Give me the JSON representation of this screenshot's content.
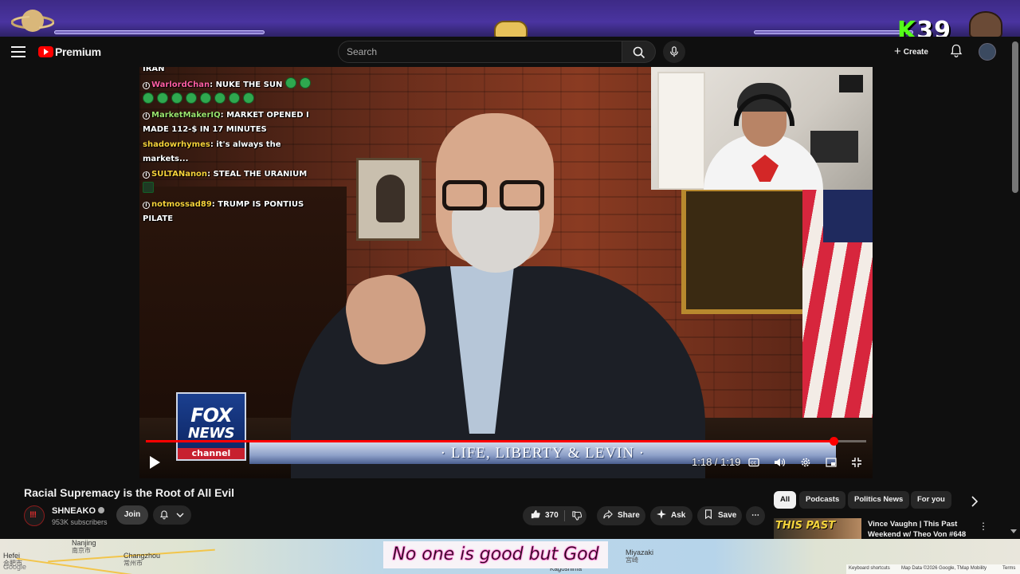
{
  "overlay": {
    "counter_k": "K",
    "counter_value": "39"
  },
  "masthead": {
    "brand": "Premium",
    "search_placeholder": "Search",
    "create_label": "Create"
  },
  "chat": [
    {
      "user": "",
      "text": "IRAN",
      "badge": false,
      "color": "#ffffff"
    },
    {
      "user": "WarlordChan",
      "text": "NUKE THE SUN",
      "badge": true,
      "color": "#ff5fa2",
      "emotes_after": 2
    },
    {
      "user": "",
      "text": "",
      "badge": false,
      "emotes_line": 8
    },
    {
      "user": "MarketMakerIQ",
      "text": "MARKET OPENED I",
      "badge": true,
      "color": "#9be36d"
    },
    {
      "user": "",
      "text": "MADE 112-$ IN 17 MINUTES",
      "badge": false
    },
    {
      "user": "shadowrhymes",
      "text": "it's always the markets...",
      "badge": false,
      "color": "#f7d23a"
    },
    {
      "user": "SULTANanon",
      "text": "STEAL THE URANIUM",
      "badge": true,
      "color": "#f7d23a"
    },
    {
      "user": "notmossad89",
      "text": "TRUMP IS PONTIUS",
      "badge": true,
      "color": "#f7d23a"
    },
    {
      "user": "",
      "text": "PILATE",
      "badge": false
    }
  ],
  "broadcast": {
    "bug_line1": "FOX",
    "bug_line2": "NEWS",
    "bug_line3": "channel",
    "lower_third": "· LIFE, LIBERTY & LEVIN ·"
  },
  "player": {
    "time": "1:18 / 1:19",
    "progress_fraction": 0.955
  },
  "video": {
    "title": "Racial Supremacy is the Root of All Evil",
    "channel": "SHNEAKO",
    "subscribers": "953K subscribers",
    "join_label": "Join",
    "like_count": "370",
    "share_label": "Share",
    "ask_label": "Ask",
    "save_label": "Save"
  },
  "chips": [
    "All",
    "Podcasts",
    "Politics News",
    "For you"
  ],
  "recommendation": {
    "thumb_text": "THIS PAST",
    "title": "Vince Vaughn | This Past Weekend w/ Theo Von #648"
  },
  "map": {
    "cities": [
      {
        "name": "Hefei",
        "sub": "合肥市"
      },
      {
        "name": "Nanjing",
        "sub": "南京市"
      },
      {
        "name": "Changzhou",
        "sub": "常州市"
      },
      {
        "name": "Miyazaki",
        "sub": "宮崎"
      },
      {
        "name": "Kagoshima",
        "sub": ""
      }
    ],
    "google": "Google",
    "footer": [
      "Keyboard shortcuts",
      "Map Data ©2026 Google, TMap Mobility",
      "Terms"
    ]
  },
  "caption": "No one is good but God"
}
